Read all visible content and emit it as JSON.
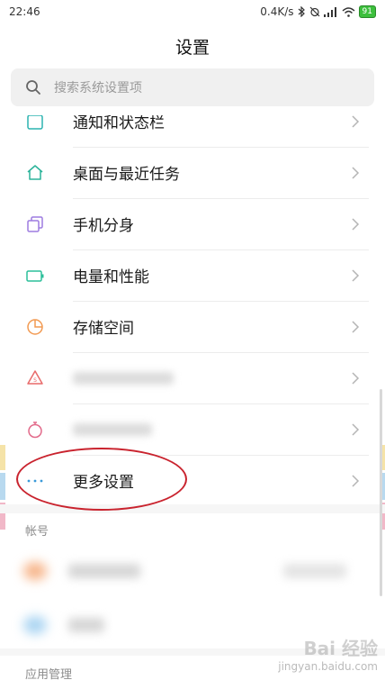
{
  "status_bar": {
    "time": "22:46",
    "speed": "0.4K/s",
    "battery": "91"
  },
  "header": {
    "title": "设置"
  },
  "search": {
    "placeholder": "搜索系统设置项"
  },
  "settings": {
    "items": [
      {
        "label": "通知和状态栏",
        "icon": "notification-icon",
        "color": "#2bb3b0"
      },
      {
        "label": "桌面与最近任务",
        "icon": "home-icon",
        "color": "#2bb39a"
      },
      {
        "label": "手机分身",
        "icon": "second-space-icon",
        "color": "#9d7ce0"
      },
      {
        "label": "电量和性能",
        "icon": "battery-icon",
        "color": "#2bbf9a"
      },
      {
        "label": "存储空间",
        "icon": "storage-icon",
        "color": "#f29a52"
      },
      {
        "label": "",
        "icon": "security-icon",
        "color": "#e86a6a"
      },
      {
        "label": "",
        "icon": "timer-icon",
        "color": "#e26a8a"
      },
      {
        "label": "更多设置",
        "icon": "more-icon",
        "color": "#3a9ad9"
      }
    ]
  },
  "sections": {
    "account": "帐号",
    "app_management": "应用管理"
  },
  "watermark": {
    "brand": "Bai 经验",
    "url": "jingyan.baidu.com"
  },
  "colors": {
    "annotation": "#c9232e",
    "search_bg": "#f0f0f0"
  }
}
